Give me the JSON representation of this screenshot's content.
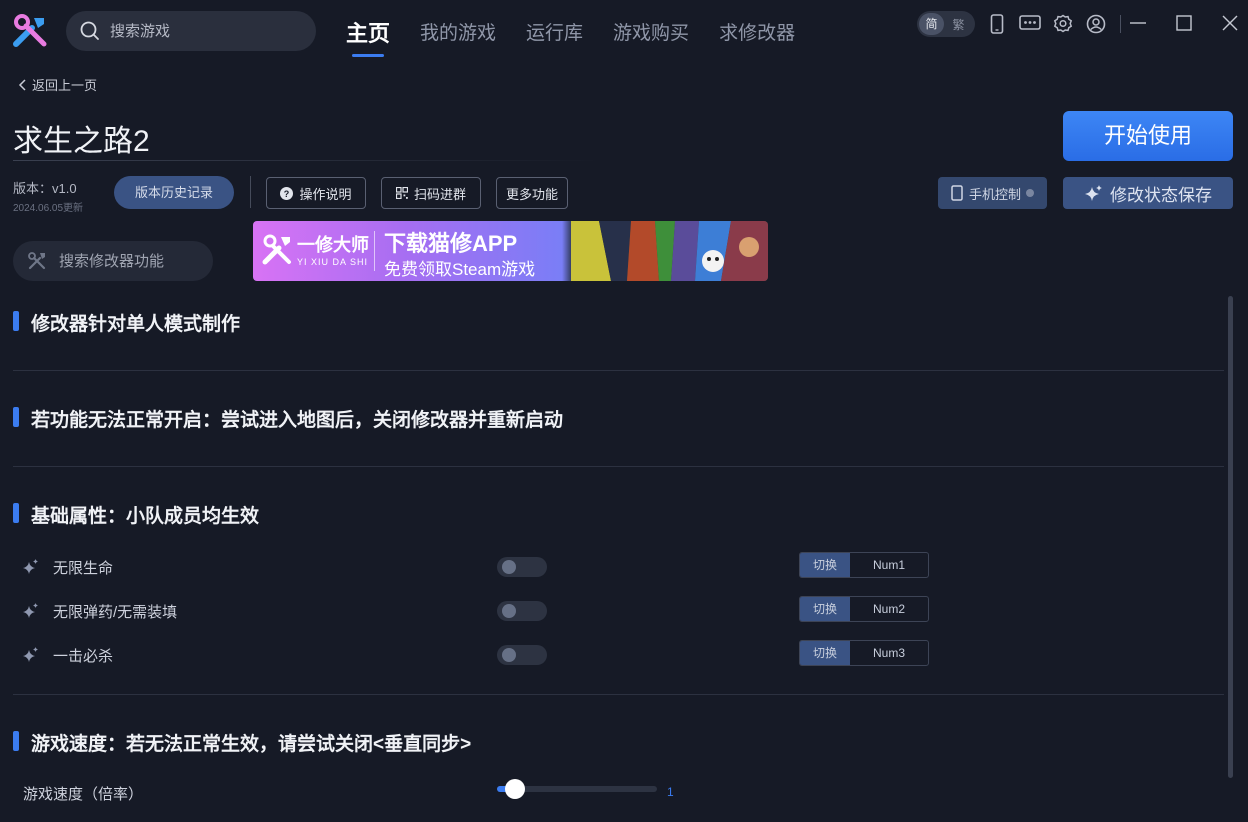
{
  "header": {
    "search_placeholder": "搜索游戏",
    "nav": [
      "主页",
      "我的游戏",
      "运行库",
      "游戏购买",
      "求修改器"
    ],
    "lang": {
      "simplified": "简",
      "traditional": "繁"
    }
  },
  "page": {
    "back_label": "返回上一页",
    "game_title": "求生之路2",
    "start_button": "开始使用",
    "version_label": "版本：v1.0",
    "version_date": "2024.06.05更新",
    "history_button": "版本历史记录",
    "help_button": "操作说明",
    "qr_button": "扫码进群",
    "more_button": "更多功能",
    "phone_control": "手机控制",
    "save_state": "修改状态保存",
    "func_search_placeholder": "搜索修改器功能"
  },
  "banner": {
    "brand_cn": "一修大师",
    "brand_en": "YI XIU DA SHI",
    "title": "下载猫修APP",
    "subtitle": "免费领取Steam游戏"
  },
  "sections": [
    {
      "title": "修改器针对单人模式制作"
    },
    {
      "title": "若功能无法正常开启：尝试进入地图后，关闭修改器并重新启动"
    },
    {
      "title": "基础属性：小队成员均生效"
    },
    {
      "title": "游戏速度：若无法正常生效，请尝试关闭<垂直同步>"
    }
  ],
  "cheats": [
    {
      "label": "无限生命",
      "enabled": false,
      "action": "切换",
      "key": "Num1"
    },
    {
      "label": "无限弹药/无需装填",
      "enabled": false,
      "action": "切换",
      "key": "Num2"
    },
    {
      "label": "一击必杀",
      "enabled": false,
      "action": "切换",
      "key": "Num3"
    }
  ],
  "speed": {
    "label": "游戏速度（倍率）",
    "value": "1",
    "fraction": 0.11
  },
  "colors": {
    "accent": "#3b7cf0",
    "background": "#161a26"
  }
}
